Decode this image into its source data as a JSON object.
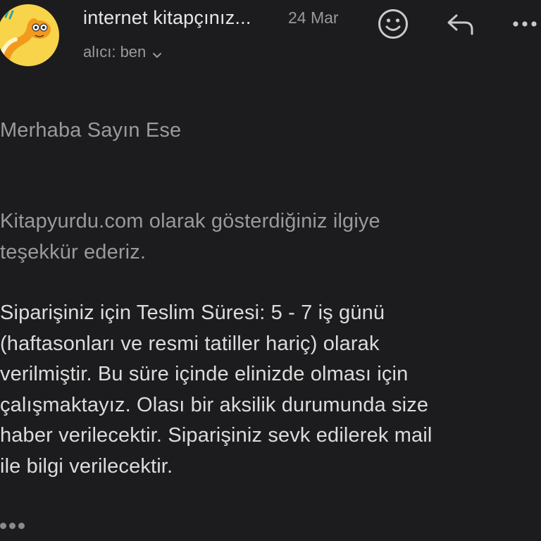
{
  "header": {
    "sender": "internet kitapçınız...",
    "date": "24 Mar",
    "recipient": "alıcı: ben",
    "icons": {
      "avatar": "cartoon-worm-avatar",
      "emoji": "smiley-icon",
      "reply": "reply-arrow-icon",
      "more": "more-horizontal-icon",
      "expand": "chevron-down-icon"
    }
  },
  "message": {
    "greeting": "Merhaba Sayın Ese",
    "paragraph1": [
      "Kitapyurdu.com olarak gösterdiğiniz ilgiye",
      "teşekkür ederiz."
    ],
    "paragraph2": [
      "Siparişiniz için Teslim Süresi: 5 - 7 iş günü",
      "(haftasonları ve resmi tatiller hariç) olarak",
      "verilmiştir. Bu süre içinde elinizde olması için",
      "çalışmaktayız. Olası bir aksilik durumunda size",
      "haber verilecektir. Siparişiniz sevk edilerek mail",
      "ile bilgi verilecektir."
    ]
  },
  "colors": {
    "background": "#1c1c1e",
    "avatar_bg": "#f7d44a",
    "primary_text": "#dcdcdc",
    "secondary_text": "#9a9a9a"
  }
}
